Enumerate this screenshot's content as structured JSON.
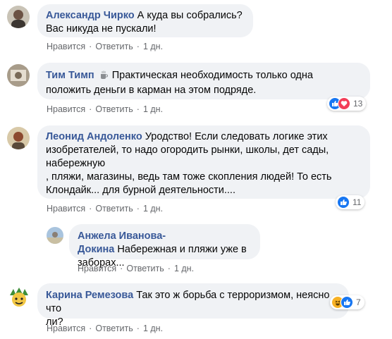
{
  "actions": {
    "like": "Нравится",
    "reply": "Ответить",
    "separator": "·"
  },
  "comments": [
    {
      "author": "Александр Чирко",
      "text": "А куда вы собрались?\nВас никуда не пускали!",
      "time": "1 дн.",
      "reaction_count": ""
    },
    {
      "author": "Тим Тимп",
      "badge_icon": "coffee-cup-icon",
      "text": "Практическая необходимость только одна\nположить деньги в карман на этом подряде.",
      "time": "1 дн.",
      "reactions": [
        "like-icon",
        "love-icon"
      ],
      "reaction_count": "13"
    },
    {
      "author": "Леонид Андоленко",
      "text": "Уродство! Если следовать логике этих изобретателей, то надо огородить рынки, школы, дет сады, набережную\n, пляжи, магазины, ведь там тоже скопления людей! То есть Клондайк... для бурной деятельности....",
      "time": "1 дн.",
      "reactions": [
        "like-icon"
      ],
      "reaction_count": "11"
    },
    {
      "author": "Анжела Иванова-Докина",
      "text": "Набережная и пляжи уже в\nзаборах...",
      "time": "1 дн.",
      "reaction_count": ""
    },
    {
      "author": "Карина Ремезова",
      "text": "Так это ж борьба с терроризмом, неясно что\nли?",
      "time": "1 дн.",
      "reactions": [
        "haha-icon",
        "like-icon"
      ],
      "reaction_count": "7"
    }
  ],
  "colors": {
    "author": "#385898",
    "bubble": "#f0f2f5",
    "meta": "#65676b",
    "like": "#1877f2",
    "love": "#f33e58",
    "haha": "#f7b125"
  }
}
